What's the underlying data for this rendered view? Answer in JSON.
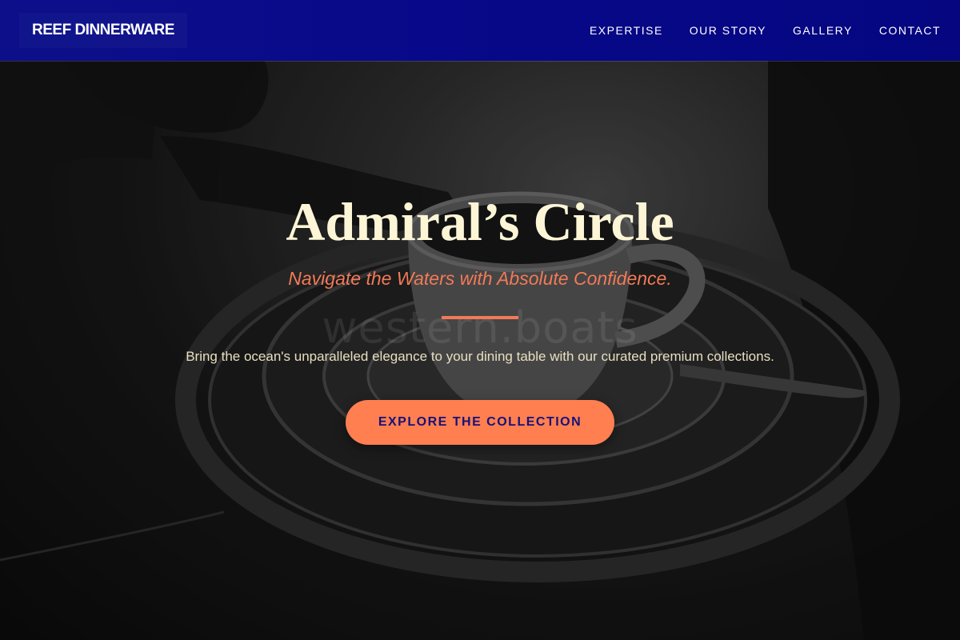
{
  "navbar": {
    "brand": "REEF DINNERWARE",
    "links": [
      "EXPERTISE",
      "OUR STORY",
      "GALLERY",
      "CONTACT"
    ]
  },
  "hero": {
    "title": "Admiral’s Circle",
    "tagline": "Navigate the Waters with Absolute Confidence.",
    "watermark": "western.boats",
    "description": "Bring the ocean's unparalleled elegance to your dining table with our curated premium collections.",
    "cta_label": "EXPLORE THE COLLECTION"
  },
  "colors": {
    "navbar": "#07098a",
    "accent": "#ff7f50",
    "title": "#fcf5d6",
    "cta_text": "#14127a"
  }
}
